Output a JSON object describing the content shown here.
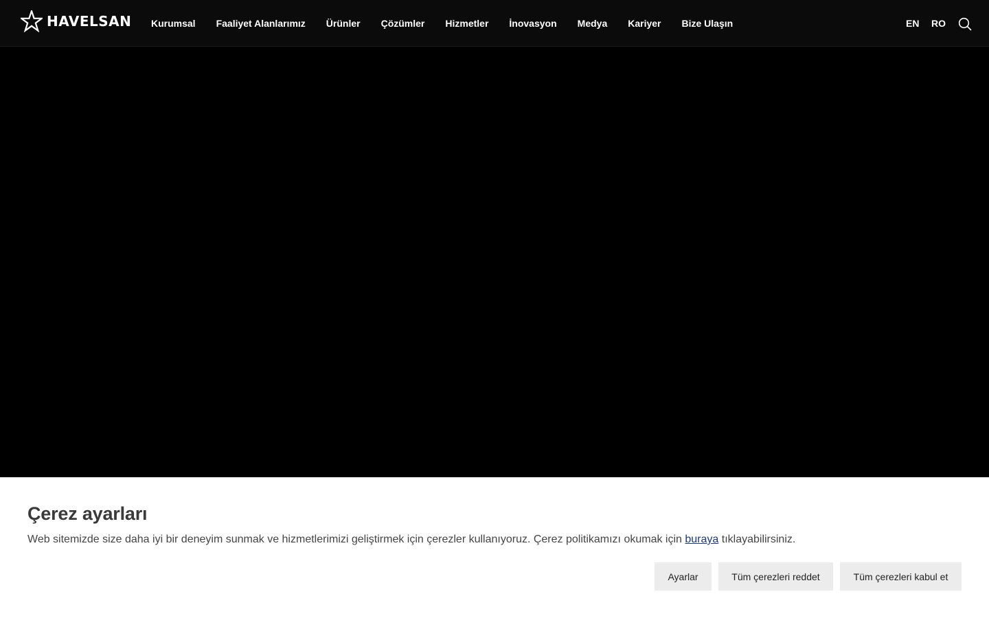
{
  "brand": {
    "name": "HAVELSAN"
  },
  "nav": {
    "items": [
      {
        "label": "Kurumsal"
      },
      {
        "label": "Faaliyet Alanlarımız"
      },
      {
        "label": "Ürünler"
      },
      {
        "label": "Çözümler"
      },
      {
        "label": "Hizmetler"
      },
      {
        "label": "İnovasyon"
      },
      {
        "label": "Medya"
      },
      {
        "label": "Kariyer"
      },
      {
        "label": "Bize Ulaşın"
      }
    ],
    "languages": [
      "EN",
      "RO"
    ],
    "search_icon": "search-icon"
  },
  "cookie": {
    "title": "Çerez ayarları",
    "text_before": "Web sitemizde size daha iyi bir deneyim sunmak ve hizmetlerimizi geliştirmek için çerezler kullanıyoruz. Çerez politikamızı okumak için ",
    "link_label": "buraya",
    "text_after": " tıklayabilirsiniz.",
    "buttons": {
      "settings": "Ayarlar",
      "reject_all": "Tüm çerezleri reddet",
      "accept_all": "Tüm çerezleri kabul et"
    }
  },
  "colors": {
    "header_bg": "#0b0b0b",
    "hero_bg": "#000000",
    "banner_bg": "#ffffff",
    "button_bg": "#ececec",
    "link": "#1e3a6e"
  }
}
